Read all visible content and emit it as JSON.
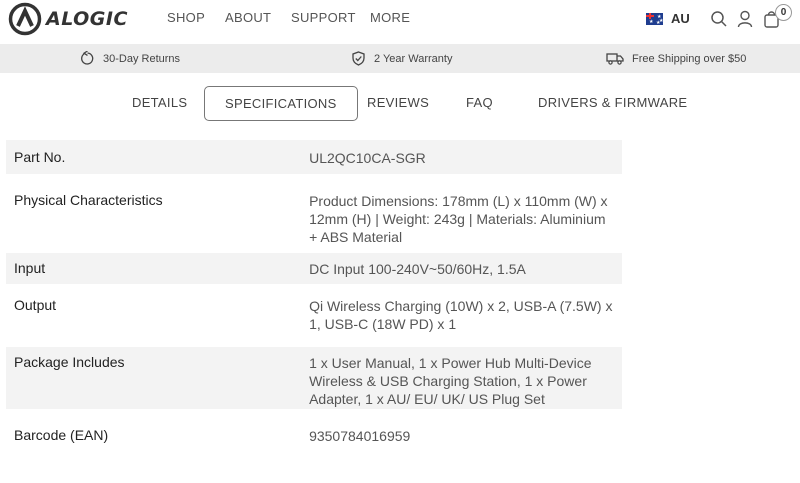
{
  "brand": {
    "name": "ALOGIC"
  },
  "nav": {
    "items": [
      "SHOP",
      "ABOUT",
      "SUPPORT",
      "MORE"
    ]
  },
  "header": {
    "region": "AU",
    "cart_count": "0"
  },
  "benefits": {
    "items": [
      "30-Day Returns",
      "2 Year Warranty",
      "Free Shipping over $50"
    ]
  },
  "tabs": {
    "items": [
      "DETAILS",
      "SPECIFICATIONS",
      "REVIEWS",
      "FAQ",
      "DRIVERS & FIRMWARE"
    ],
    "active": "SPECIFICATIONS"
  },
  "specs": [
    {
      "label": "Part No.",
      "value": "UL2QC10CA-SGR"
    },
    {
      "label": "Physical Characteristics",
      "value": "Product Dimensions: 178mm (L) x 110mm (W) x 12mm (H) | Weight: 243g | Materials: Aluminium + ABS Material"
    },
    {
      "label": "Input",
      "value": "DC Input 100-240V~50/60Hz, 1.5A"
    },
    {
      "label": "Output",
      "value": "Qi Wireless Charging (10W) x 2, USB-A (7.5W) x 1, USB-C (18W PD) x 1"
    },
    {
      "label": "Package Includes",
      "value": "1 x User Manual, 1 x Power Hub Multi-Device Wireless & USB Charging Station, 1 x Power Adapter, 1 x AU/ EU/ UK/ US Plug Set"
    },
    {
      "label": "Barcode (EAN)",
      "value": "9350784016959"
    }
  ],
  "icons": [
    "logo-icon",
    "flag-au-icon",
    "search-icon",
    "account-icon",
    "cart-icon",
    "returns-icon",
    "warranty-shield-icon",
    "shipping-truck-icon"
  ]
}
